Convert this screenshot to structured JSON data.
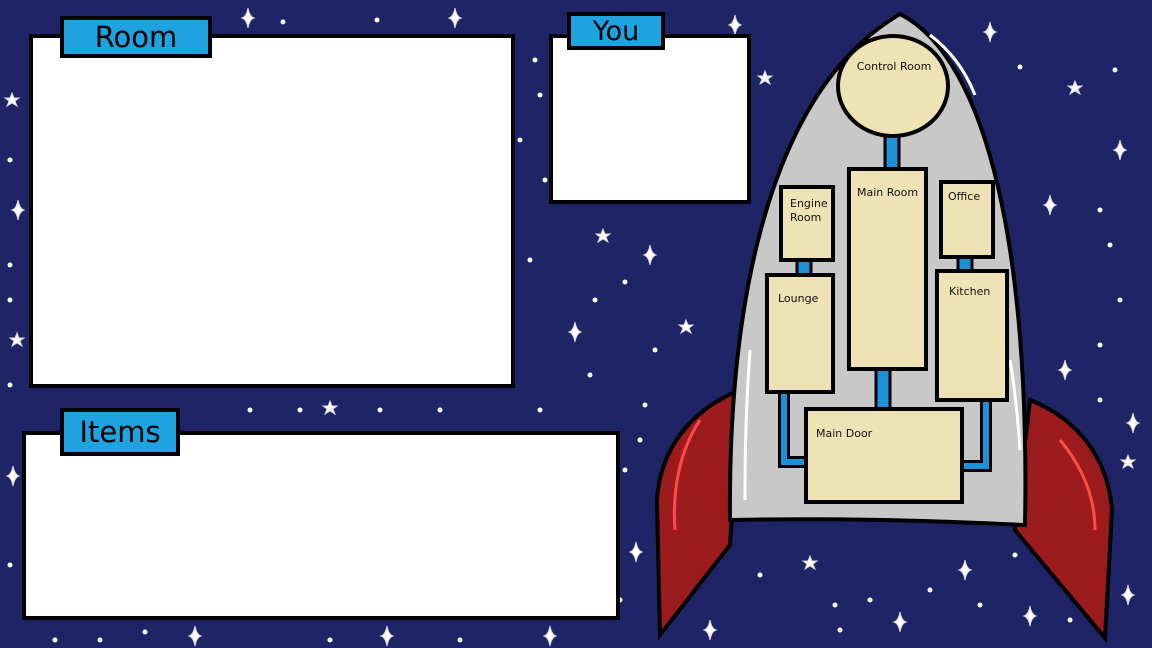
{
  "panels": {
    "room": {
      "title": "Room"
    },
    "you": {
      "title": "You"
    },
    "items": {
      "title": "Items"
    }
  },
  "ship_map": {
    "rooms": {
      "control_room": "Control Room",
      "main_room": "Main Room",
      "engine_room": "Engine Room",
      "office": "Office",
      "lounge": "Lounge",
      "kitchen": "Kitchen",
      "main_door": "Main Door"
    }
  },
  "colors": {
    "background": "#1f2466",
    "tab": "#1ea3e0",
    "panel": "#ffffff",
    "room_fill": "#efe3b6",
    "corridor": "#1e90d8",
    "hull": "#c8c8c8",
    "fin": "#9b1b1f"
  }
}
